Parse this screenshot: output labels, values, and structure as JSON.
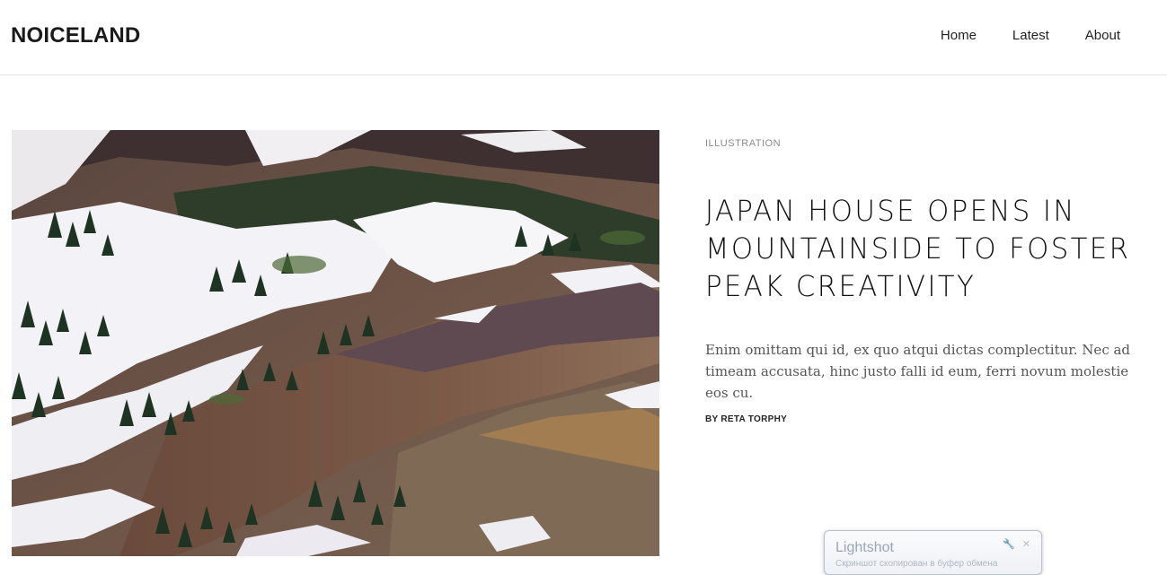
{
  "site": {
    "logo": "NOICELAND"
  },
  "nav": {
    "items": [
      "Home",
      "Latest",
      "About"
    ]
  },
  "article": {
    "category": "ILLUSTRATION",
    "title": "JAPAN HOUSE OPENS IN MOUNTAINSIDE TO FOSTER PEAK CREATIVITY",
    "excerpt": "Enim omittam qui id, ex quo atqui dictas complectitur. Nec ad timeam accusata, hinc justo falli id eum, ferri novum molestie eos cu.",
    "byline": "BY RETA TORPHY",
    "image_alt": "mountainside-snow-photo"
  },
  "lightshot": {
    "title": "Lightshot",
    "message": "Скриншот скопирован в буфер обмена"
  },
  "colors": {
    "text": "#111111",
    "muted": "#8a8a8a",
    "divider": "#e5e5e5"
  }
}
